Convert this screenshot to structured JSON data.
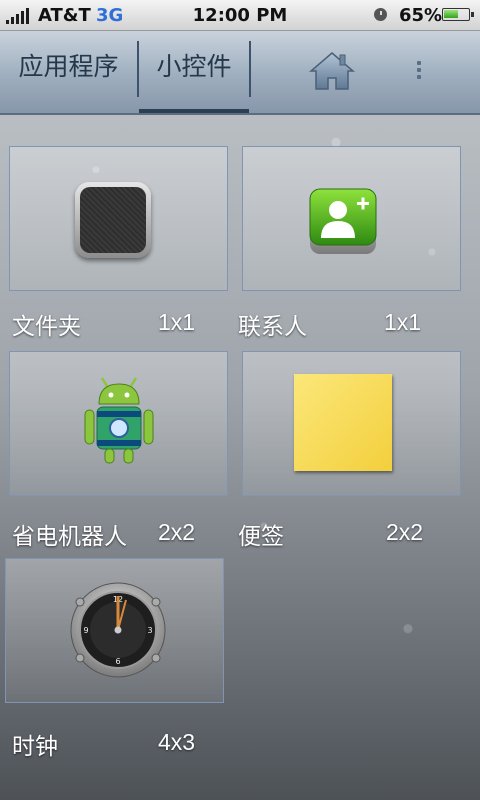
{
  "status_bar": {
    "carrier": "AT&T",
    "network": "3G",
    "time": "12:00 PM",
    "battery_percent": "65%",
    "battery_level": 0.65,
    "icons": [
      "signal-icon",
      "alarm-icon",
      "battery-icon"
    ]
  },
  "tabbar": {
    "tab_apps": "应用程序",
    "tab_widgets": "小控件",
    "selected_tab": "小控件",
    "icons": [
      "home-icon",
      "menu-icon"
    ]
  },
  "widgets": [
    {
      "label": "文件夹",
      "size": "1x1",
      "icon": "folder-icon"
    },
    {
      "label": "联系人",
      "size": "1x1",
      "icon": "add-contact-icon"
    },
    {
      "label": "省电机器人",
      "size": "2x2",
      "icon": "android-battery-icon"
    },
    {
      "label": "便签",
      "size": "2x2",
      "icon": "sticky-note-icon"
    },
    {
      "label": "时钟",
      "size": "4x3",
      "icon": "clock-icon"
    }
  ],
  "colors": {
    "accent": "#2f6fd6",
    "tab_text": "#24384d",
    "tile_border": "#7f95b3",
    "note_yellow": "#f7d94f",
    "android_green": "#8cc63f"
  }
}
